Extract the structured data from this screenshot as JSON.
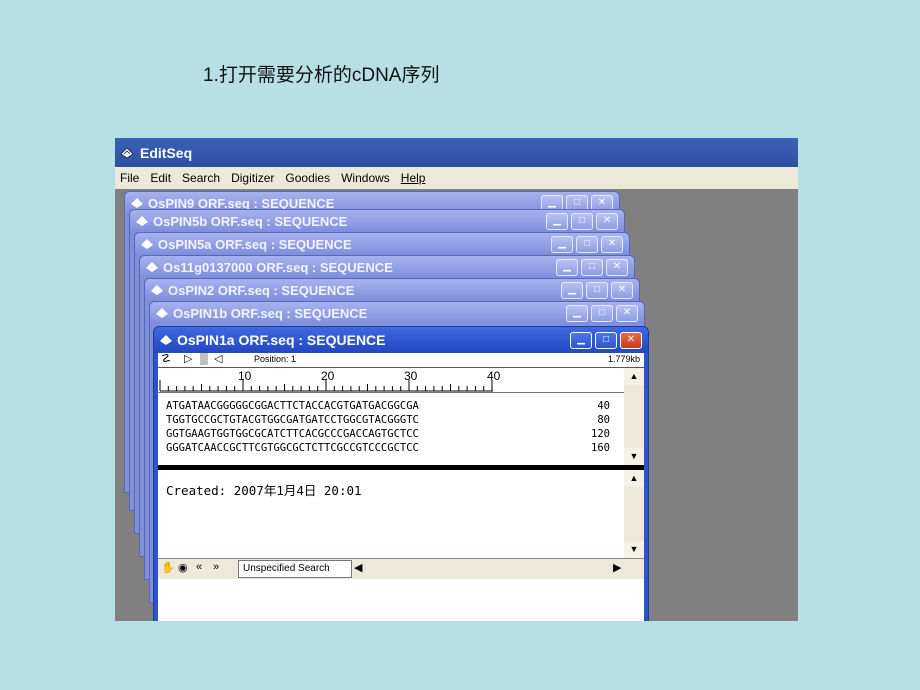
{
  "slide": {
    "title": "1.打开需要分析的cDNA序列"
  },
  "app": {
    "title": "EditSeq",
    "menu": [
      "File",
      "Edit",
      "Search",
      "Digitizer",
      "Goodies",
      "Windows",
      "Help"
    ]
  },
  "windows": [
    {
      "title": "OsPIN9 ORF.seq : SEQUENCE"
    },
    {
      "title": "OsPIN5b ORF.seq : SEQUENCE"
    },
    {
      "title": "OsPIN5a ORF.seq : SEQUENCE"
    },
    {
      "title": "Os11g0137000 ORF.seq : SEQUENCE"
    },
    {
      "title": "OsPIN2 ORF.seq : SEQUENCE"
    },
    {
      "title": "OsPIN1b ORF.seq : SEQUENCE"
    }
  ],
  "active_window": {
    "title": "OsPIN1a ORF.seq : SEQUENCE",
    "position_label": "Position: 1",
    "size_label": "1.779kb",
    "ruler": [
      "10",
      "20",
      "30",
      "40"
    ],
    "sequence_rows": [
      {
        "seq": "ATGATAACGGGGGCGGACTTCTACCACGTGATGACGGCGA",
        "num": "40"
      },
      {
        "seq": "TGGTGCCGCTGTACGTGGCGATGATCCTGGCGTACGGGTC",
        "num": "80"
      },
      {
        "seq": "GGTGAAGTGGTGGCGCATCTTCACGCCCGACCAGTGCTCC",
        "num": "120"
      },
      {
        "seq": "GGGATCAACCGCTTCGTGGCGCTCTTCGCCGTCCCGCTCC",
        "num": "160"
      }
    ],
    "notes": "Created: 2007年1月4日 20:01",
    "search_mode": "Unspecified Search"
  },
  "icons": {
    "app": "editseq-icon",
    "minimize": "minimize-icon",
    "maximize": "maximize-icon",
    "close": "close-icon"
  }
}
